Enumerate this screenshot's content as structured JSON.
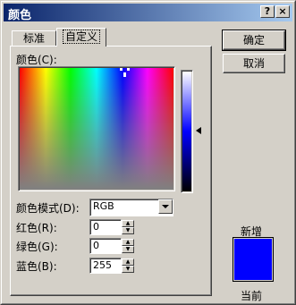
{
  "window": {
    "title": "颜色",
    "help_label": "?",
    "close_label": "×"
  },
  "tabs": [
    {
      "label": "标准"
    },
    {
      "label": "自定义"
    }
  ],
  "buttons": {
    "ok": "确定",
    "cancel": "取消"
  },
  "colors_label": "颜色(C):",
  "color_model": {
    "label": "颜色模式(D):",
    "value": "RGB"
  },
  "red": {
    "label": "红色(R):",
    "value": "0"
  },
  "green": {
    "label": "绿色(G):",
    "value": "0"
  },
  "blue": {
    "label": "蓝色(B):",
    "value": "255"
  },
  "preview": {
    "new_label": "新增",
    "current_label": "当前",
    "new_color": "#0000ff",
    "current_color": "#0000ff"
  },
  "colors": {
    "titlebar_start": "#0a246a",
    "titlebar_end": "#a6caf0",
    "selected": "#0000ff"
  }
}
